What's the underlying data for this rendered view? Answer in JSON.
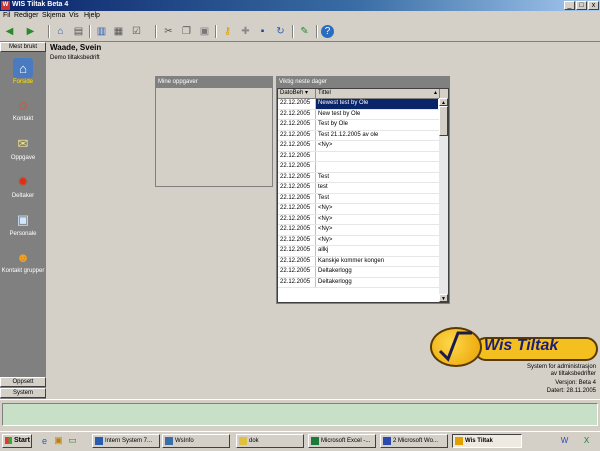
{
  "window": {
    "title": "WIS Tiltak Beta 4",
    "minimize": "_",
    "maximize": "□",
    "close": "x"
  },
  "menu": [
    "Fil",
    "Rediger",
    "Skjema",
    "Vis",
    "Hjelp"
  ],
  "toolbar_icons": [
    "back-icon",
    "forward-icon",
    "home-icon",
    "print-icon",
    "layout-icon",
    "grid-icon",
    "check-icon",
    "cut-icon",
    "copy-icon",
    "paste-icon",
    "key-icon",
    "add-icon",
    "save-icon",
    "refresh-icon",
    "edit-icon",
    "help-icon"
  ],
  "sidebar": {
    "header": "Mest brukt",
    "items": [
      {
        "label": "Forside",
        "icon": "home-icon"
      },
      {
        "label": "Kontakt",
        "icon": "contact-icon"
      },
      {
        "label": "Oppgave",
        "icon": "task-icon"
      },
      {
        "label": "Deltaker",
        "icon": "participant-icon"
      },
      {
        "label": "Personale",
        "icon": "staff-icon"
      },
      {
        "label": "Kontakt grupper",
        "icon": "groups-icon"
      }
    ],
    "footer": [
      "Oppsett",
      "System"
    ]
  },
  "header": {
    "name": "Waade, Svein",
    "company": "Demo tiltaksbedrift"
  },
  "panels": {
    "tasks": {
      "title": "Mine oppgaver"
    },
    "important": {
      "title": "Viktig neste dager",
      "columns": [
        "DatoBeh",
        "Tittel"
      ],
      "rows": [
        [
          "22.12.2005",
          "Newest test by Ole"
        ],
        [
          "22.12.2005",
          "New test by Ole"
        ],
        [
          "22.12.2005",
          "Test by Ole"
        ],
        [
          "22.12.2005",
          "Test 21.12.2005 av ole"
        ],
        [
          "22.12.2005",
          "<Ny>"
        ],
        [
          "22.12.2005",
          ""
        ],
        [
          "22.12.2005",
          ""
        ],
        [
          "22.12.2005",
          "Test"
        ],
        [
          "22.12.2005",
          "test"
        ],
        [
          "22.12.2005",
          "Test"
        ],
        [
          "22.12.2005",
          "<Ny>"
        ],
        [
          "22.12.2005",
          "<Ny>"
        ],
        [
          "22.12.2005",
          "<Ny>"
        ],
        [
          "22.12.2005",
          "<Ny>"
        ],
        [
          "22.12.2005",
          "allkj"
        ],
        [
          "22.12.2005",
          "Kanskje kommer kongen"
        ],
        [
          "22.12.2005",
          "Deltakerlogg"
        ],
        [
          "22.12.2005",
          "Deltakerlogg"
        ]
      ]
    }
  },
  "logo": {
    "name": "Wis Tiltak",
    "line1": "System for administrasjon",
    "line2": "av tiltaksbedrifter",
    "version": "Versjon: Beta 4",
    "date": "Datert: 28.11.2005"
  },
  "taskbar": {
    "start": "Start",
    "tasks": [
      "Intern System 7...",
      "WsInfo",
      "dok",
      "Microsoft Excel -...",
      "2 Microsoft Wo...",
      "Wis Tiltak"
    ]
  }
}
